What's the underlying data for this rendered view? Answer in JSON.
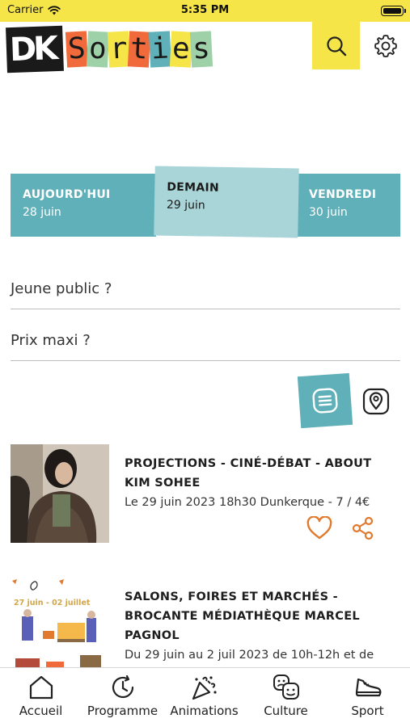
{
  "status_bar": {
    "carrier": "Carrier",
    "time": "5:35 PM"
  },
  "header": {
    "logo_dk": "DK",
    "logo_letters": [
      "S",
      "o",
      "r",
      "t",
      "i",
      "e",
      "s"
    ],
    "logo_letter_colors": [
      "#f06a3b",
      "#9fd1a9",
      "#f5e548",
      "#f06a3b",
      "#5fb0b8",
      "#f5e548",
      "#9fd1a9"
    ],
    "icons": {
      "search": "search-icon",
      "settings": "gear-icon"
    }
  },
  "day_tabs": [
    {
      "name": "AUJOURD'HUI",
      "date": "28 juin"
    },
    {
      "name": "DEMAIN",
      "date": "29 juin"
    },
    {
      "name": "VENDREDI",
      "date": "30 juin"
    }
  ],
  "filters": {
    "young_public": "Jeune public ?",
    "max_price": "Prix maxi ?"
  },
  "view_toggle": {
    "list_icon": "list-icon",
    "map_icon": "map-pin-icon"
  },
  "events": [
    {
      "title_line1": "PROJECTIONS - CINÉ-DÉBAT - ABOUT",
      "title_line2": "KIM SOHEE",
      "meta": "Le 29 juin 2023 18h30 Dunkerque - 7 / 4€"
    },
    {
      "title_line1": "SALONS, FOIRES ET MARCHÉS -",
      "title_line2": "BROCANTE MÉDIATHÈQUE MARCEL",
      "title_line3": "PAGNOL",
      "meta": "Du 29 juin au 2 juil 2023 de 10h-12h et de",
      "poster_text": "27 juin - 02 juillet"
    }
  ],
  "bottom_nav": [
    {
      "label": "Accueil",
      "icon": "home-icon"
    },
    {
      "label": "Programme",
      "icon": "clock-icon"
    },
    {
      "label": "Animations",
      "icon": "party-icon"
    },
    {
      "label": "Culture",
      "icon": "theater-masks-icon"
    },
    {
      "label": "Sport",
      "icon": "sneaker-icon"
    }
  ],
  "colors": {
    "accent_yellow": "#f5e548",
    "accent_teal": "#5fb0b8",
    "tab_selected": "#a9d5d8",
    "action_orange": "#e07a2e"
  }
}
